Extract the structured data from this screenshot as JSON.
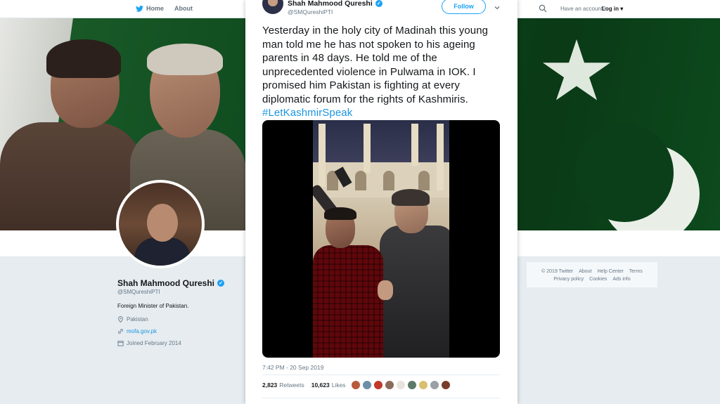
{
  "nav": {
    "home_label": "Home",
    "about_label": "About",
    "have_account": "Have an account?",
    "login_label": "Log in"
  },
  "profile": {
    "name": "Shah Mahmood Qureshi",
    "handle": "@SMQureshiPTI",
    "bio": "Foreign Minister of Pakistan.",
    "location": "Pakistan",
    "url": "mofa.gov.pk",
    "joined": "Joined February 2014"
  },
  "footer": {
    "row1": [
      "© 2019 Twitter",
      "About",
      "Help Center",
      "Terms"
    ],
    "row2": [
      "Privacy policy",
      "Cookies",
      "Ads info"
    ]
  },
  "tweet": {
    "author_name": "Shah Mahmood Qureshi",
    "author_handle": "@SMQureshiPTI",
    "follow_label": "Follow",
    "text": "Yesterday in the holy city of Madinah this young man told me he has not spoken to his ageing parents in 48 days. He told me of the unprecedented violence in Pulwama in IOK. I promised him Pakistan is fighting at every diplomatic forum for the rights of Kashmiris.",
    "hashtag": "#LetKashmirSpeak",
    "timestamp": "7:42 PM - 20 Sep 2019",
    "retweets_count": "2,823",
    "retweets_label": "Retweets",
    "likes_count": "10,623",
    "likes_label": "Likes"
  },
  "colors": {
    "accent": "#1da1f2",
    "link": "#1b95e0",
    "text": "#14171a",
    "muted": "#657786"
  },
  "likers": [
    "#b85a3c",
    "#6d8fa8",
    "#c0392b",
    "#8b6b5a",
    "#e8e3dc",
    "#5b7a6a",
    "#d8c070",
    "#9aa0a6",
    "#7a3d2a"
  ]
}
